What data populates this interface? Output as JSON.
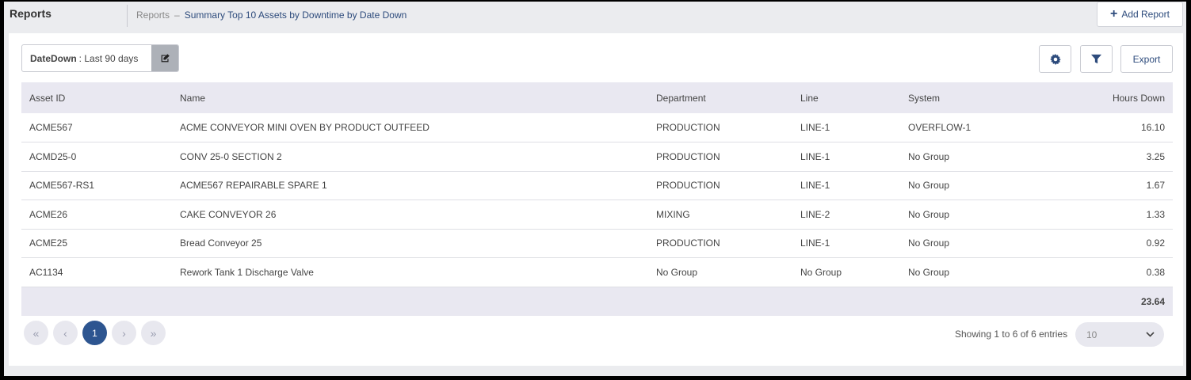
{
  "header": {
    "title": "Reports",
    "breadcrumb": {
      "root": "Reports",
      "separator": "–",
      "current": "Summary Top 10 Assets by Downtime by Date Down"
    },
    "add_report_label": "Add Report"
  },
  "filter": {
    "field": "DateDown",
    "value": ": Last 90 days"
  },
  "toolbar": {
    "export_label": "Export"
  },
  "table": {
    "columns": [
      "Asset ID",
      "Name",
      "Department",
      "Line",
      "System",
      "Hours Down"
    ],
    "rows": [
      [
        "ACME567",
        "ACME CONVEYOR MINI OVEN BY PRODUCT OUTFEED",
        "PRODUCTION",
        "LINE-1",
        "OVERFLOW-1",
        "16.10"
      ],
      [
        "ACMD25-0",
        "CONV 25-0 SECTION 2",
        "PRODUCTION",
        "LINE-1",
        "No Group",
        "3.25"
      ],
      [
        "ACME567-RS1",
        "ACME567 REPAIRABLE SPARE 1",
        "PRODUCTION",
        "LINE-1",
        "No Group",
        "1.67"
      ],
      [
        "ACME26",
        "CAKE CONVEYOR 26",
        "MIXING",
        "LINE-2",
        "No Group",
        "1.33"
      ],
      [
        "ACME25",
        "Bread Conveyor 25",
        "PRODUCTION",
        "LINE-1",
        "No Group",
        "0.92"
      ],
      [
        "AC1134",
        "Rework Tank 1 Discharge Valve",
        "No Group",
        "No Group",
        "No Group",
        "0.38"
      ]
    ],
    "total": "23.64"
  },
  "pagination": {
    "current_page": "1",
    "showing_text": "Showing 1 to 6 of 6 entries",
    "page_size": "10"
  },
  "colors": {
    "accent": "#2d4b7c",
    "active_page": "#2d5590",
    "header_bg": "#e9e8f1"
  }
}
